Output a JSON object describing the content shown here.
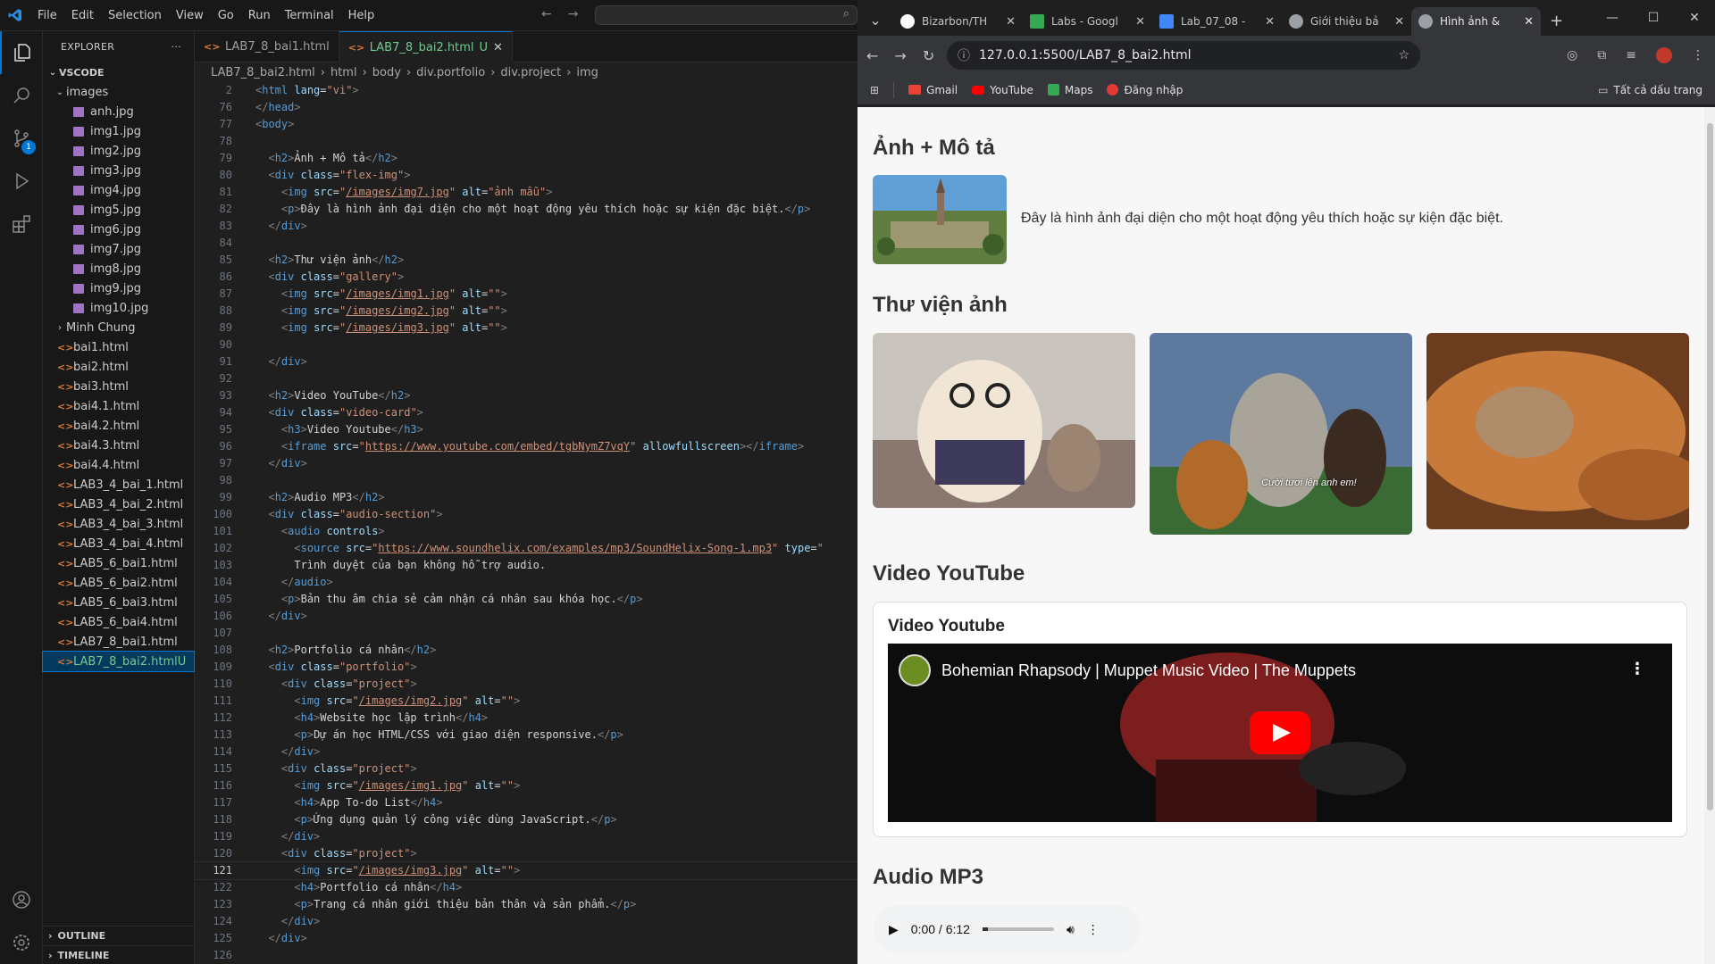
{
  "vscode": {
    "menu": [
      "File",
      "Edit",
      "Selection",
      "View",
      "Go",
      "Run",
      "Terminal",
      "Help"
    ],
    "explorer_title": "EXPLORER",
    "workspace": "VSCODE",
    "tree": {
      "images_folder": "images",
      "images": [
        "anh.jpg",
        "img1.jpg",
        "img2.jpg",
        "img3.jpg",
        "img4.jpg",
        "img5.jpg",
        "img6.jpg",
        "img7.jpg",
        "img8.jpg",
        "img9.jpg",
        "img10.jpg"
      ],
      "minh_chung": "Minh Chung",
      "html_files": [
        "bai1.html",
        "bai2.html",
        "bai3.html",
        "bai4.1.html",
        "bai4.2.html",
        "bai4.3.html",
        "bai4.4.html",
        "LAB3_4_bai_1.html",
        "LAB3_4_bai_2.html",
        "LAB3_4_bai_3.html",
        "LAB3_4_bai_4.html",
        "LAB5_6_bai1.html",
        "LAB5_6_bai2.html",
        "LAB5_6_bai3.html",
        "LAB5_6_bai4.html",
        "LAB7_8_bai1.html"
      ],
      "selected_file": "LAB7_8_bai2.html",
      "selected_flag": "U"
    },
    "outline": "OUTLINE",
    "timeline": "TIMELINE",
    "tabs": [
      {
        "label": "LAB7_8_bai1.html",
        "flag": ""
      },
      {
        "label": "LAB7_8_bai2.html",
        "flag": "U"
      }
    ],
    "breadcrumb": [
      "LAB7_8_bai2.html",
      "html",
      "body",
      "div.portfolio",
      "div.project",
      "img"
    ],
    "current_line": "121"
  },
  "browser": {
    "tabs": [
      {
        "label": "Bizarbon/TH",
        "color": "#ffffff"
      },
      {
        "label": "Labs - Googl",
        "color": "#34a853"
      },
      {
        "label": "Lab_07_08 - ",
        "color": "#4285f4"
      },
      {
        "label": "Giới thiệu bả",
        "color": "#9aa0a6"
      },
      {
        "label": "Hình ảnh & ",
        "color": "#9aa0a6"
      }
    ],
    "url": "127.0.0.1:5500/LAB7_8_bai2.html",
    "bookmarks": [
      {
        "label": "Gmail",
        "color": "#ea4335"
      },
      {
        "label": "YouTube",
        "color": "#ff0000"
      },
      {
        "label": "Maps",
        "color": "#34a853"
      },
      {
        "label": "Đăng nhập",
        "color": "#e53935"
      }
    ],
    "all_bookmarks": "Tất cả dấu trang"
  },
  "page": {
    "h_image_desc": "Ảnh + Mô tả",
    "image_desc_text": "Đây là hình ảnh đại diện cho một hoạt động yêu thích hoặc sự kiện đặc biệt.",
    "h_gallery": "Thư viện ảnh",
    "gallery_caption": "Cười tươi lên anh em!",
    "h_video": "Video YouTube",
    "video_card_title": "Video Youtube",
    "video_title": "Bohemian Rhapsody | Muppet Music Video | The Muppets",
    "h_audio": "Audio MP3",
    "audio_time": "0:00 / 6:12"
  }
}
